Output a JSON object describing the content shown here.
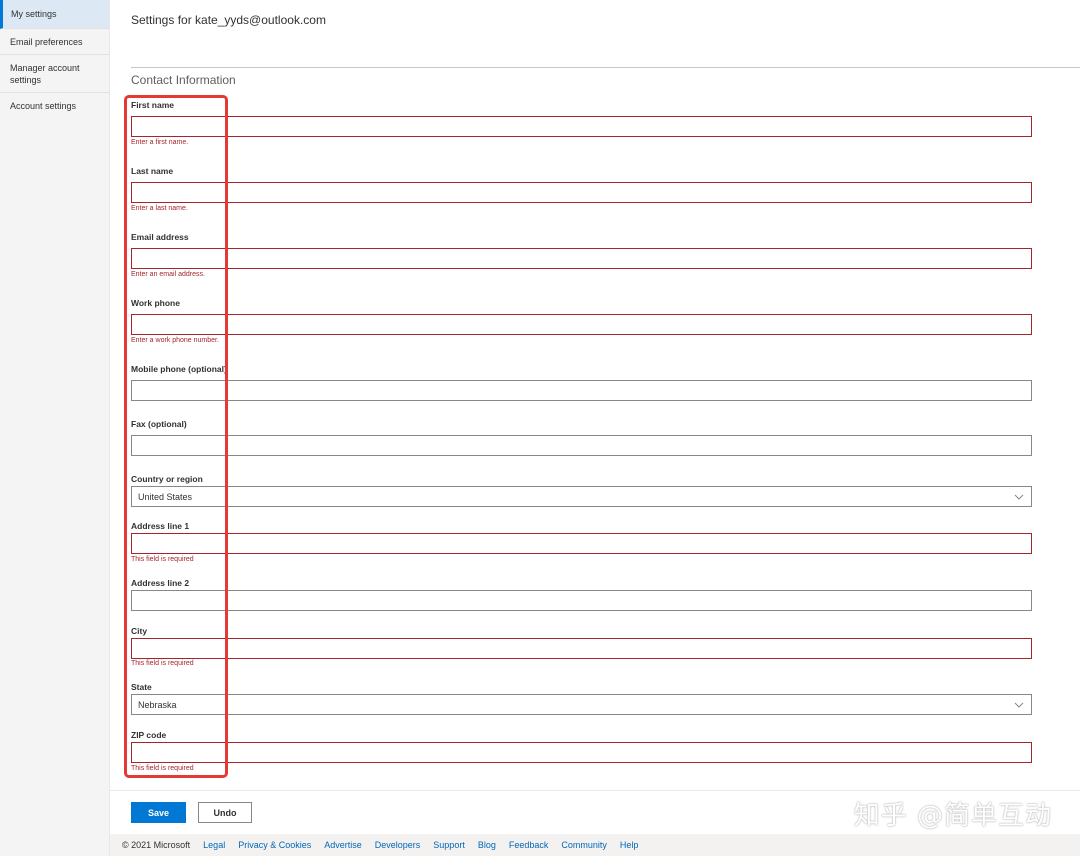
{
  "sidebar": {
    "items": [
      {
        "label": "My settings",
        "active": true
      },
      {
        "label": "Email preferences",
        "active": false
      },
      {
        "label": "Manager account settings",
        "active": false
      },
      {
        "label": "Account settings",
        "active": false
      }
    ]
  },
  "page": {
    "title": "Settings for kate_yyds@outlook.com",
    "section_title": "Contact Information"
  },
  "form": {
    "first_name": {
      "label": "First name",
      "value": "",
      "error": "Enter a first name."
    },
    "last_name": {
      "label": "Last name",
      "value": "",
      "error": "Enter a last name."
    },
    "email": {
      "label": "Email address",
      "value": "",
      "error": "Enter an email address."
    },
    "work_phone": {
      "label": "Work phone",
      "value": "",
      "error": "Enter a work phone number."
    },
    "mobile_phone": {
      "label": "Mobile phone (optional)",
      "value": ""
    },
    "fax": {
      "label": "Fax (optional)",
      "value": ""
    },
    "country": {
      "label": "Country or region",
      "value": "United States"
    },
    "address1": {
      "label": "Address line 1",
      "value": "",
      "error": "This field is required"
    },
    "address2": {
      "label": "Address line 2",
      "value": ""
    },
    "city": {
      "label": "City",
      "value": "",
      "error": "This field is required"
    },
    "state": {
      "label": "State",
      "value": "Nebraska"
    },
    "zip": {
      "label": "ZIP code",
      "value": "",
      "error": "This field is required"
    }
  },
  "actions": {
    "save_label": "Save",
    "undo_label": "Undo"
  },
  "footer": {
    "copyright": "© 2021 Microsoft",
    "links": [
      "Legal",
      "Privacy & Cookies",
      "Advertise",
      "Developers",
      "Support",
      "Blog",
      "Feedback",
      "Community",
      "Help"
    ]
  },
  "watermark": "知乎 @简单互动",
  "colors": {
    "accent": "#0078d4",
    "error": "#a4262c",
    "annotation": "#e53935"
  }
}
